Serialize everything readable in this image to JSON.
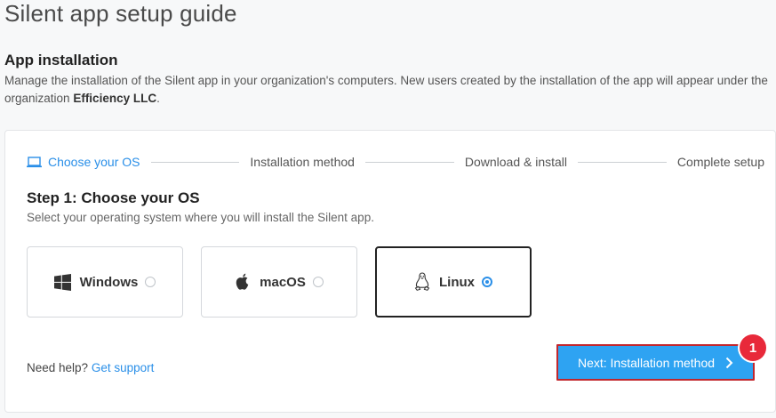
{
  "page": {
    "title": "Silent app setup guide"
  },
  "section": {
    "title": "App installation",
    "desc_before": "Manage the installation of the Silent app in your organization's computers. New users created by the installation of the app will appear under the organization ",
    "org_name": "Efficiency LLC",
    "desc_after": "."
  },
  "stepper": {
    "steps": [
      {
        "label": "Choose your OS",
        "active": true
      },
      {
        "label": "Installation method",
        "active": false
      },
      {
        "label": "Download & install",
        "active": false
      },
      {
        "label": "Complete setup",
        "active": false
      }
    ]
  },
  "step1": {
    "title": "Step 1: Choose your OS",
    "desc": "Select your operating system where you will install the Silent app."
  },
  "os_options": [
    {
      "label": "Windows",
      "icon": "windows-icon",
      "selected": false
    },
    {
      "label": "macOS",
      "icon": "apple-icon",
      "selected": false
    },
    {
      "label": "Linux",
      "icon": "linux-icon",
      "selected": true
    }
  ],
  "help": {
    "prefix": "Need help?",
    "link": "Get support"
  },
  "next_button": {
    "label": "Next: Installation method"
  },
  "badge": {
    "value": "1"
  },
  "colors": {
    "accent": "#2a8fe8",
    "button": "#2ea3f2",
    "highlight_border": "#c2272d",
    "badge": "#e8293a"
  }
}
